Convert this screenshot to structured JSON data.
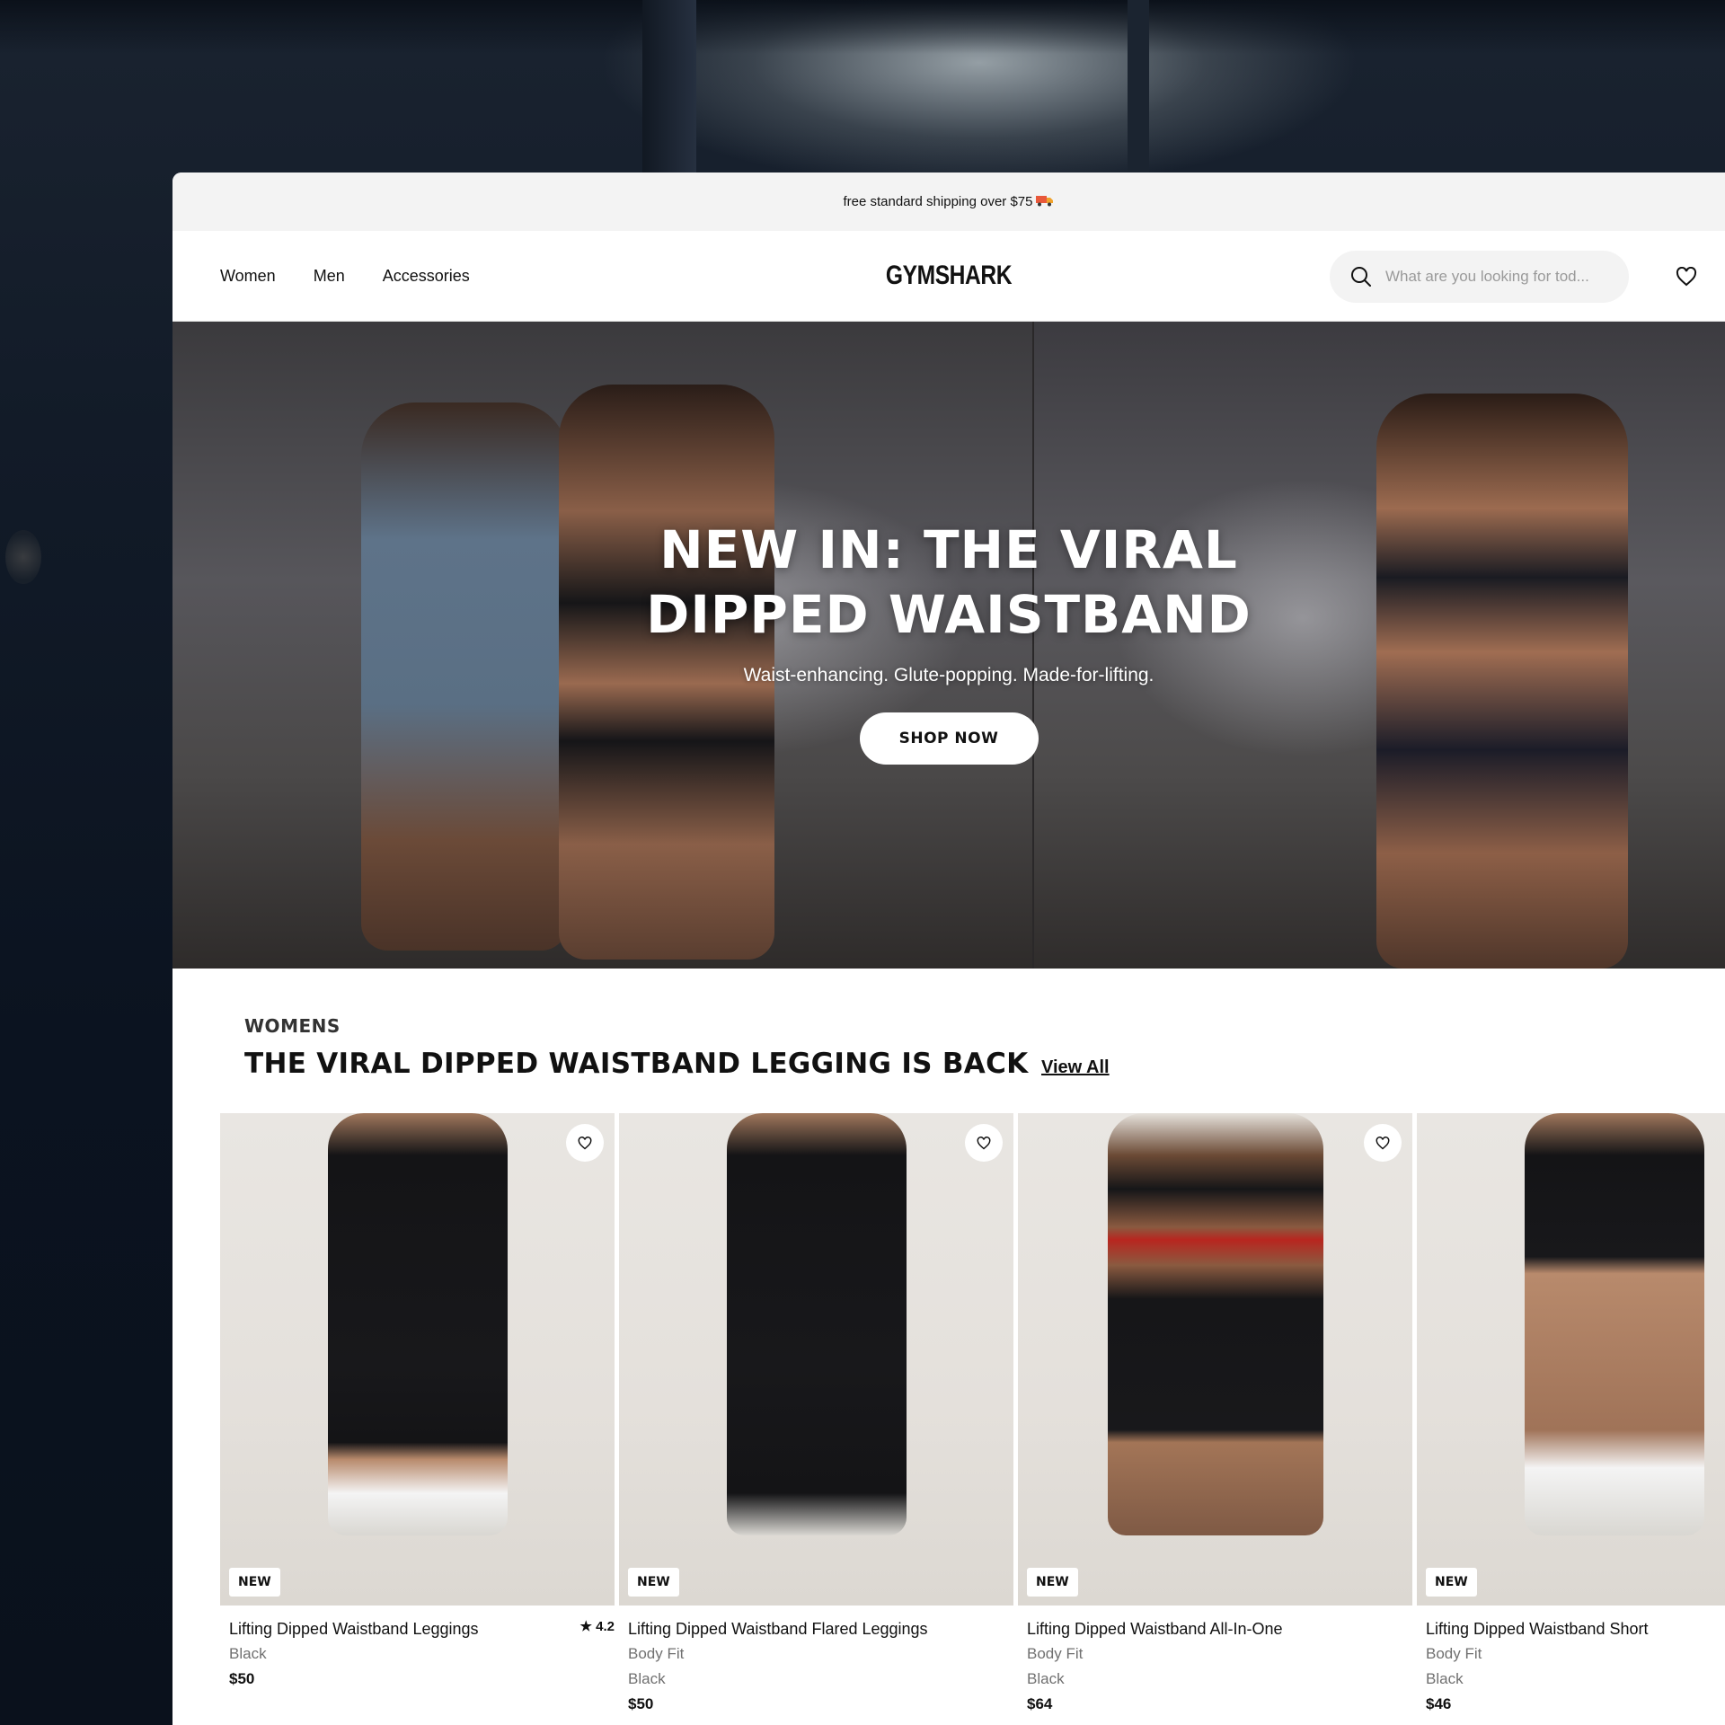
{
  "promo": {
    "text": "free standard shipping over $75",
    "icon": "truck-icon"
  },
  "header": {
    "nav": [
      {
        "label": "Women"
      },
      {
        "label": "Men"
      },
      {
        "label": "Accessories"
      }
    ],
    "logo": "GYMSHARK",
    "search": {
      "placeholder": "What are you looking for tod..."
    }
  },
  "hero": {
    "title_line1": "NEW IN: THE VIRAL",
    "title_line2": "DIPPED WAISTBAND",
    "subtitle": "Waist-enhancing. Glute-popping. Made-for-lifting.",
    "cta": "SHOP NOW"
  },
  "section": {
    "eyebrow": "WOMENS",
    "title": "THE VIRAL DIPPED WAISTBAND LEGGING IS BACK",
    "view_all": "View All"
  },
  "products": [
    {
      "badge": "NEW",
      "name": "Lifting Dipped Waistband Leggings",
      "fit": "",
      "color": "Black",
      "price": "$50",
      "rating": "★ 4.2"
    },
    {
      "badge": "NEW",
      "name": "Lifting Dipped Waistband Flared Leggings",
      "fit": "Body Fit",
      "color": "Black",
      "price": "$50",
      "rating": ""
    },
    {
      "badge": "NEW",
      "name": "Lifting Dipped Waistband All-In-One",
      "fit": "Body Fit",
      "color": "Black",
      "price": "$64",
      "rating": ""
    },
    {
      "badge": "NEW",
      "name": "Lifting Dipped Waistband Short",
      "fit": "Body Fit",
      "color": "Black",
      "price": "$46",
      "rating": ""
    }
  ],
  "colors": {
    "promo_bg": "#f3f3f3",
    "text": "#111111",
    "muted": "#707070",
    "accent_strap": "#b8261f"
  }
}
